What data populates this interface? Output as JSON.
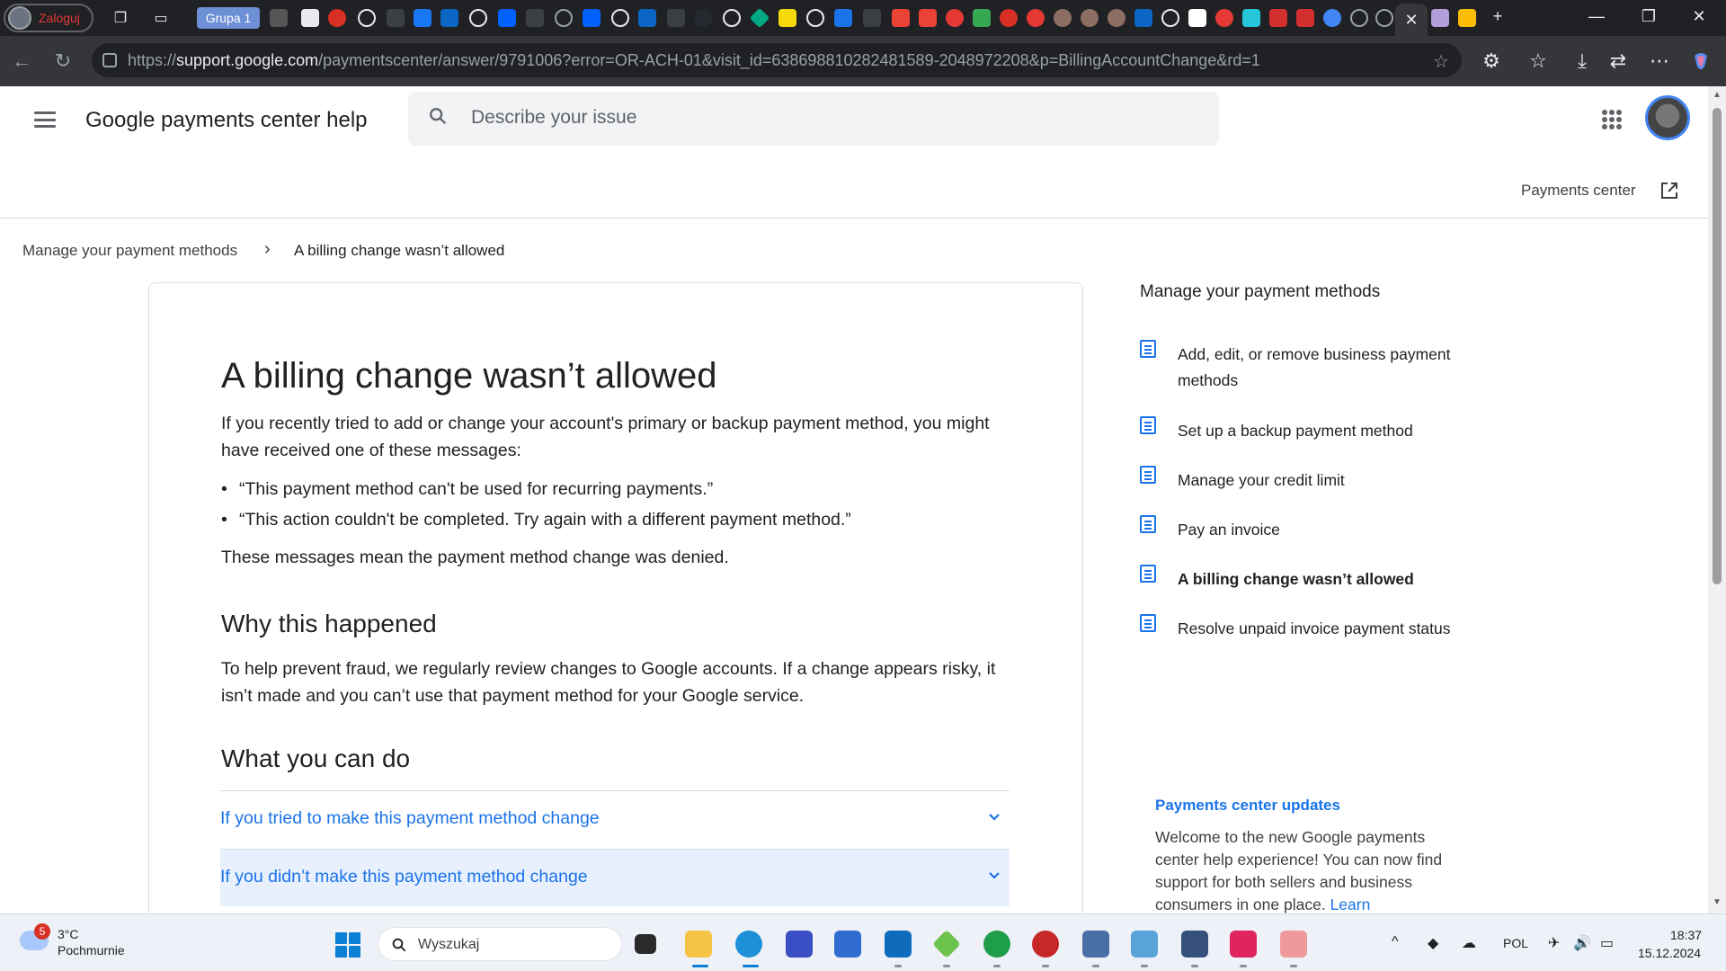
{
  "browser": {
    "profile_label": "Zaloguj",
    "tab_group_label": "Grupa 1",
    "url_prefix": "https://",
    "url_domain": "support.google.com",
    "url_rest": "/paymentscenter/answer/9791006?error=OR-ACH-01&visit_id=638698810282481589-2048972208&p=BillingAccountChange&rd=1"
  },
  "header": {
    "site_title": "Google payments center help",
    "search_placeholder": "Describe your issue",
    "payments_center_link": "Payments center"
  },
  "breadcrumb": {
    "parent": "Manage your payment methods",
    "current": "A billing change wasn’t allowed"
  },
  "article": {
    "title": "A billing change wasn’t allowed",
    "intro": "If you recently tried to add or change your account's primary or backup payment method, you might have received one of these messages:",
    "messages": [
      "“This payment method can't be used for recurring payments.”",
      "“This action couldn't be completed. Try again with a different payment method.”"
    ],
    "meaning": "These messages mean the payment method change was denied.",
    "why_heading": "Why this happened",
    "why_text": "To help prevent fraud, we regularly review changes to Google accounts. If a change appears risky, it isn’t made and you can’t use that payment method for your Google service.",
    "what_heading": "What you can do",
    "accordions": [
      "If you tried to make this payment method change",
      "If you didn’t make this payment method change"
    ]
  },
  "sidebar": {
    "title": "Manage your payment methods",
    "items": [
      {
        "label": "Add, edit, or remove business payment methods"
      },
      {
        "label": "Set up a backup payment method"
      },
      {
        "label": "Manage your credit limit"
      },
      {
        "label": "Pay an invoice"
      },
      {
        "label": "A billing change wasn’t allowed"
      },
      {
        "label": "Resolve unpaid invoice payment status"
      }
    ],
    "updates_title": "Payments center updates",
    "updates_text": "Welcome to the new Google payments center help experience! You can now find support for both sellers and business consumers in one place.",
    "updates_link": "Learn"
  },
  "taskbar": {
    "weather_badge": "5",
    "weather_temp": "3°C",
    "weather_cond": "Pochmurnie",
    "search_text": "Wyszukaj",
    "language": "POL",
    "time": "18:37",
    "date": "15.12.2024"
  },
  "colors": {
    "link_blue": "#1a73e8",
    "accordion_highlight": "#e8f0fe",
    "chrome_dark": "#202124"
  }
}
